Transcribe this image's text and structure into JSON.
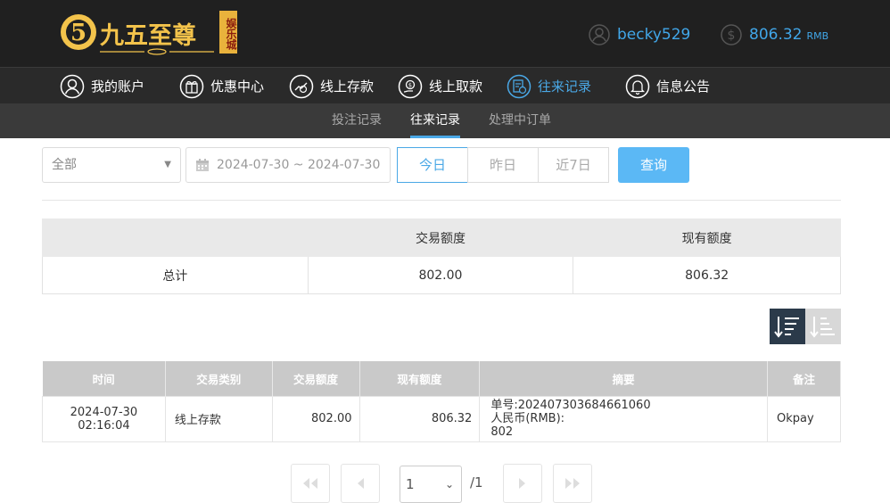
{
  "brand": {
    "name": "九五至尊",
    "tag": "娱乐城",
    "logo_digit": "5"
  },
  "account": {
    "username": "becky529",
    "balance": "806.32",
    "currency": "RMB"
  },
  "nav": {
    "items": [
      {
        "label": "我的账户",
        "icon": "user-icon"
      },
      {
        "label": "优惠中心",
        "icon": "gift-icon"
      },
      {
        "label": "线上存款",
        "icon": "deposit-icon"
      },
      {
        "label": "线上取款",
        "icon": "withdraw-icon"
      },
      {
        "label": "往来记录",
        "icon": "records-icon",
        "active": true
      },
      {
        "label": "信息公告",
        "icon": "bell-icon"
      }
    ]
  },
  "subnav": {
    "items": [
      {
        "label": "投注记录"
      },
      {
        "label": "往来记录",
        "active": true
      },
      {
        "label": "处理中订单"
      }
    ]
  },
  "filter": {
    "type_selected": "全部",
    "date_range": "2024-07-30 ~ 2024-07-30",
    "quick": [
      "今日",
      "昨日",
      "近7日"
    ],
    "quick_active": "今日",
    "query_label": "查询"
  },
  "summary": {
    "headers": [
      "",
      "交易额度",
      "现有额度"
    ],
    "row": {
      "label": "总计",
      "amount": "802.00",
      "balance": "806.32"
    }
  },
  "records": {
    "headers": [
      "时间",
      "交易类别",
      "交易额度",
      "现有额度",
      "摘要",
      "备注"
    ],
    "rows": [
      {
        "time": "2024-07-30 02:16:04",
        "type": "线上存款",
        "amount": "802.00",
        "balance": "806.32",
        "summary_lines": [
          "单号:202407303684661060",
          "人民币(RMB):",
          "802"
        ],
        "note": "Okpay"
      }
    ]
  },
  "pagination": {
    "current": "1",
    "total": "/1"
  },
  "colors": {
    "accent": "#4aa8e6",
    "topbar": "#202020",
    "nav": "#2a2a2a",
    "subnav": "#3a3a3a",
    "query_button": "#5bb8f5",
    "sort_active": "#2b3a4a",
    "gold": "#f3c34b"
  }
}
